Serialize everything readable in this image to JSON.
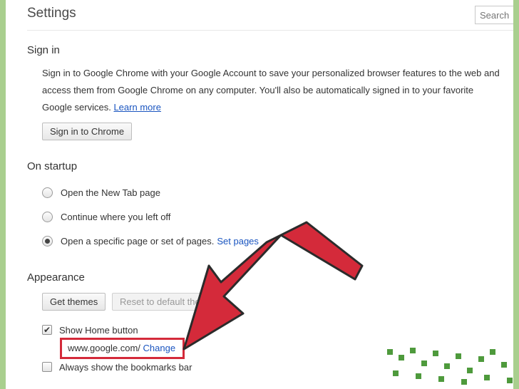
{
  "header": {
    "title": "Settings",
    "search_placeholder": "Search"
  },
  "sign_in": {
    "heading": "Sign in",
    "description_line1": "Sign in to Google Chrome with your Google Account to save your personalized browser features to the web and",
    "description_line2": "access them from Google Chrome on any computer. You'll also be automatically signed in to your favorite",
    "description_line3": "Google services.",
    "learn_more": "Learn more",
    "button": "Sign in to Chrome"
  },
  "startup": {
    "heading": "On startup",
    "options": [
      {
        "label": "Open the New Tab page",
        "checked": false
      },
      {
        "label": "Continue where you left off",
        "checked": false
      },
      {
        "label": "Open a specific page or set of pages.",
        "checked": true
      }
    ],
    "set_pages": "Set pages"
  },
  "appearance": {
    "heading": "Appearance",
    "get_themes": "Get themes",
    "reset_theme": "Reset to default theme",
    "show_home_button": {
      "label": "Show Home button",
      "checked": true
    },
    "home_url": "www.google.com/",
    "change": "Change",
    "bookmarks_bar": {
      "label": "Always show the bookmarks bar",
      "checked": false
    }
  },
  "colors": {
    "highlight": "#d42a3a",
    "link": "#1a55c0",
    "background": "#a9cf8e"
  },
  "annotation": {
    "arrow_icon": "red-arrow-icon"
  }
}
